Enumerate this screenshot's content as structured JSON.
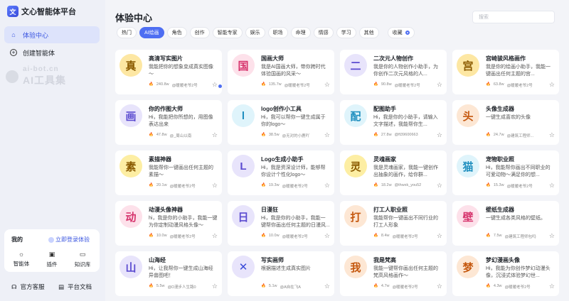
{
  "app": {
    "title": "文心智能体平台",
    "logo_char": "文心"
  },
  "sidebar": {
    "items": [
      {
        "label": "体验中心",
        "icon": "home-icon"
      },
      {
        "label": "创建智能体",
        "icon": "plus-circle-icon"
      }
    ],
    "watermark_top": "ai-bot.cn",
    "watermark_bottom": "AI工具集",
    "my_title": "我的",
    "login_label": "立即登录体验",
    "quick": [
      {
        "label": "智能体",
        "icon": "sun-icon"
      },
      {
        "label": "插件",
        "icon": "plugin-icon"
      },
      {
        "label": "知识库",
        "icon": "knowledge-icon"
      }
    ],
    "footer": [
      {
        "label": "官方客服",
        "icon": "headset-icon"
      },
      {
        "label": "平台文档",
        "icon": "document-icon"
      }
    ]
  },
  "main": {
    "title": "体验中心",
    "search_placeholder": "搜索",
    "filters": [
      "热门",
      "AI绘画",
      "角色",
      "创作",
      "智能专家",
      "娱乐",
      "职场",
      "命理",
      "情感",
      "学习",
      "其他"
    ],
    "active_filter": "AI绘画",
    "collect_label": "收藏"
  },
  "colors": {
    "accent": "#4e6ef2"
  },
  "cards": [
    {
      "char": "真",
      "bg": "#fde7a3",
      "fg": "#8a5a00",
      "title": "高清写实图片",
      "desc": "我能把你的想象变成真实图像～",
      "count": "240.8w",
      "author": "@暖暖老爷2号"
    },
    {
      "char": "国",
      "bg": "#fde1ea",
      "fg": "#d6336c",
      "title": "国画大师",
      "desc": "我是AI国画大师，带你跨时代体验国画的风采～",
      "count": "135.7w",
      "author": "@暖暖老爷2号"
    },
    {
      "char": "二",
      "bg": "#e8e4fb",
      "fg": "#5b4bd0",
      "title": "二次元人物创作",
      "desc": "我是你的人物创作小助手，为你创作二次元风格的人...",
      "count": "90.8w",
      "author": "@暖暖老爷2号"
    },
    {
      "char": "宫",
      "bg": "#fde7a3",
      "fg": "#8a5a00",
      "title": "宫崎骏风格画作",
      "desc": "我是你的绘画小助手，我能一键画出任何主题的宫...",
      "count": "63.8w",
      "author": "@暖暖老爷2号"
    },
    {
      "char": "画",
      "bg": "#e8e4fb",
      "fg": "#5b4bd0",
      "title": "你的作图大师",
      "desc": "Hi，我能把你所想的，用图像表达出来",
      "count": "47.8w",
      "author": "@_周山以南"
    },
    {
      "char": "l",
      "bg": "#dff4fb",
      "fg": "#1f8fbf",
      "title": "logo创作小工具",
      "desc": "Hi，我可以帮你一键生成属于你的logo～",
      "count": "38.5w",
      "author": "@无对的小鹿吖"
    },
    {
      "char": "配",
      "bg": "#dff4fb",
      "fg": "#1f8fbf",
      "title": "配图助手",
      "desc": "Hi，我是你的小助手，请输入文字描述，我能帮你生...",
      "count": "27.8w",
      "author": "@ft39600663"
    },
    {
      "char": "头",
      "bg": "#fde7d4",
      "fg": "#c5580f",
      "title": "头像生成器",
      "desc": "一键生成喜欢的头像",
      "count": "24.7w",
      "author": "@建筑工程师..."
    },
    {
      "char": "素",
      "bg": "#fdeea3",
      "fg": "#8a5a00",
      "title": "素描神器",
      "desc": "我能帮你一键画出任何主题的素描～",
      "count": "20.1w",
      "author": "@暖暖老爷2号"
    },
    {
      "char": "L",
      "bg": "#e8e4fb",
      "fg": "#5b4bd0",
      "title": "Logo生成小助手",
      "desc": "Hi，我是资深设计师，能够帮你设计个性化logo～",
      "count": "19.3w",
      "author": "@暖暖老爷2号"
    },
    {
      "char": "灵",
      "bg": "#fdeea3",
      "fg": "#8a5a00",
      "title": "灵魂画家",
      "desc": "我是灵魂画家，我能一键创作出抽象的画作，给你群...",
      "count": "18.2w",
      "author": "@thwxk_you52"
    },
    {
      "char": "猫",
      "bg": "#dff4fb",
      "fg": "#1f8fbf",
      "title": "宠物职业照",
      "desc": "Hi，我能帮你画出不同职业的可爱动物～满足你的想...",
      "count": "15.3w",
      "author": "@暖暖老爷2号"
    },
    {
      "char": "动",
      "bg": "#fde1ea",
      "fg": "#d6336c",
      "title": "动漫头像神器",
      "desc": "hi，我是你的小助手，我能一键为你定制动漫风格头像～",
      "count": "10.0w",
      "author": "@暖暖老爷2号"
    },
    {
      "char": "日",
      "bg": "#e8e4fb",
      "fg": "#5b4bd0",
      "title": "日漫狂",
      "desc": "Hi，我是你的小助手，我能一键帮你画出任何主题的日漫风...",
      "count": "10.0w",
      "author": "@暖暖老爷2号"
    },
    {
      "char": "打",
      "bg": "#fde7d4",
      "fg": "#c5580f",
      "title": "打工人职业照",
      "desc": "我能帮你一键画出不同行业的打工人形象",
      "count": "8.4w",
      "author": "@暖暖老爷2号"
    },
    {
      "char": "壁",
      "bg": "#fde1ea",
      "fg": "#d6336c",
      "title": "壁纸生成器",
      "desc": "一键生成各类风格的壁纸。",
      "count": "7.5w",
      "author": "@建筑工程师包吗"
    },
    {
      "char": "山",
      "bg": "#e8e4fb",
      "fg": "#5b4bd0",
      "title": "山海经",
      "desc": "Hi，让我帮你一键生成山海经异兽图吧！",
      "count": "5.5w",
      "author": "@D漫步人生路0"
    },
    {
      "char": "✕",
      "bg": "#e8e4fb",
      "fg": "#3a4bd8",
      "title": "写实画师",
      "desc": "根据描述生成真实图片",
      "count": "5.1w",
      "author": "@A自在飞A"
    },
    {
      "char": "我",
      "bg": "#fde7d4",
      "fg": "#c5580f",
      "title": "我是梵高",
      "desc": "我能一键帮你画出任何主题的梵高风格画作～",
      "count": "4.7w",
      "author": "@暖暖老爷2号"
    },
    {
      "char": "梦",
      "bg": "#fde7d4",
      "fg": "#c5580f",
      "title": "梦幻漫画头像",
      "desc": "Hi，我能为你创作梦幻动漫头像，沉浸式体验梦幻世...",
      "count": "4.3w",
      "author": "@暖暖老爷2号"
    }
  ]
}
